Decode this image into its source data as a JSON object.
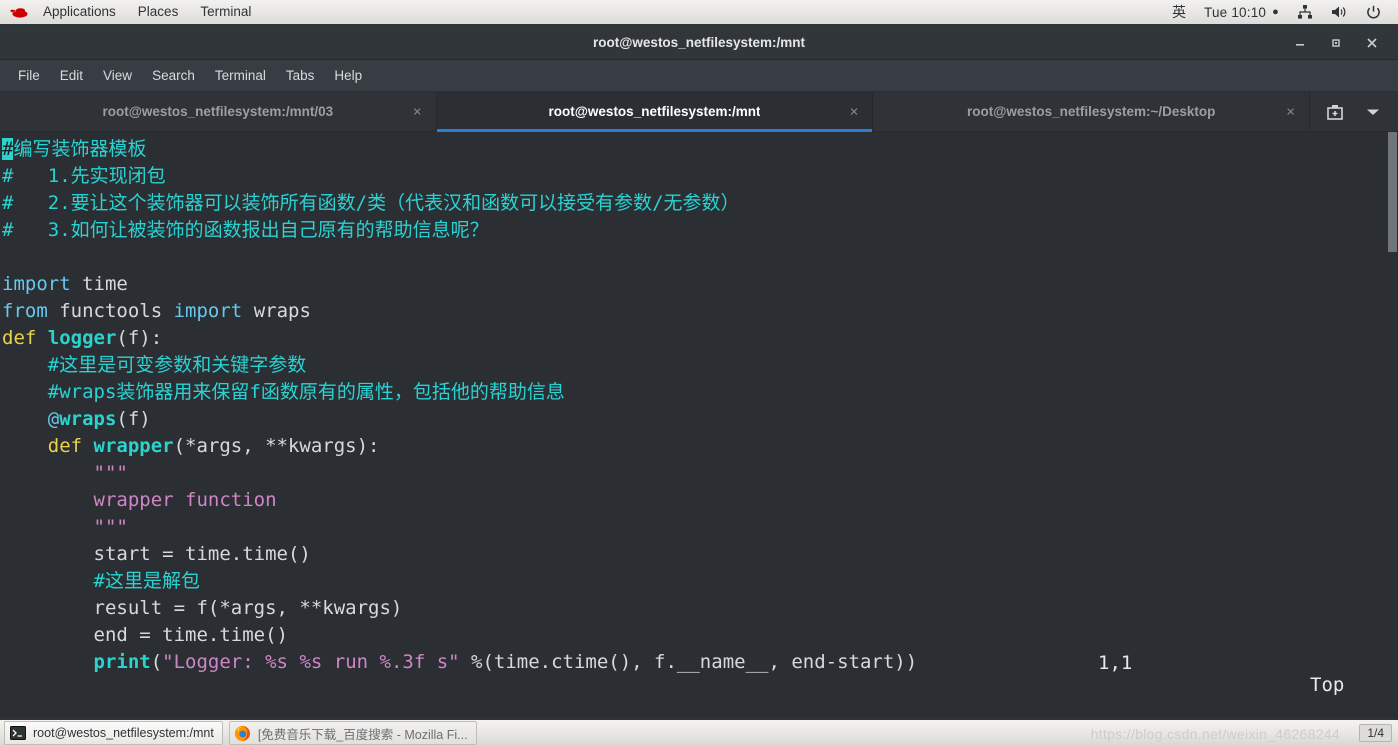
{
  "top_panel": {
    "logo_name": "red-hat-logo",
    "menus": [
      "Applications",
      "Places",
      "Terminal"
    ],
    "ime": "英",
    "clock": "Tue 10:10",
    "clock_dot": "●",
    "icons": [
      "network-icon",
      "volume-icon",
      "power-icon"
    ]
  },
  "window": {
    "title": "root@westos_netfilesystem:/mnt",
    "buttons": [
      "minimize-button",
      "maximize-button",
      "close-button"
    ]
  },
  "menubar": [
    "File",
    "Edit",
    "View",
    "Search",
    "Terminal",
    "Tabs",
    "Help"
  ],
  "tabs": [
    {
      "title": "root@westos_netfilesystem:/mnt/03",
      "active": false,
      "close": "×"
    },
    {
      "title": "root@westos_netfilesystem:/mnt",
      "active": true,
      "close": "×"
    },
    {
      "title": "root@westos_netfilesystem:~/Desktop",
      "active": false,
      "close": "×"
    }
  ],
  "tab_tools": [
    "new-tab-icon",
    "tab-list-dropdown-icon"
  ],
  "terminal": {
    "lines": [
      [
        {
          "t": "#",
          "c": "cursor"
        },
        {
          "t": "编写装饰器模板",
          "c": "c-comment"
        }
      ],
      [
        {
          "t": "#   1.先实现闭包",
          "c": "c-comment"
        }
      ],
      [
        {
          "t": "#   2.要让这个装饰器可以装饰所有函数/类（代表汉和函数可以接受有参数/无参数）",
          "c": "c-comment"
        }
      ],
      [
        {
          "t": "#   3.如何让被装饰的函数报出自己原有的帮助信息呢？",
          "c": "c-comment"
        }
      ],
      [
        {
          "t": "",
          "c": "c-plain"
        }
      ],
      [
        {
          "t": "import",
          "c": "c-kw"
        },
        {
          "t": " time",
          "c": "c-plain"
        }
      ],
      [
        {
          "t": "from",
          "c": "c-kw"
        },
        {
          "t": " functools ",
          "c": "c-plain"
        },
        {
          "t": "import",
          "c": "c-kw"
        },
        {
          "t": " wraps",
          "c": "c-plain"
        }
      ],
      [
        {
          "t": "def ",
          "c": "c-def"
        },
        {
          "t": "logger",
          "c": "c-fn"
        },
        {
          "t": "(f):",
          "c": "c-plain"
        }
      ],
      [
        {
          "t": "    #这里是可变参数和关键字参数",
          "c": "c-comment"
        }
      ],
      [
        {
          "t": "    #wraps装饰器用来保留f函数原有的属性，包括他的帮助信息",
          "c": "c-comment"
        }
      ],
      [
        {
          "t": "    @",
          "c": "c-kw"
        },
        {
          "t": "wraps",
          "c": "c-fn"
        },
        {
          "t": "(f)",
          "c": "c-plain"
        }
      ],
      [
        {
          "t": "    def ",
          "c": "c-def"
        },
        {
          "t": "wrapper",
          "c": "c-fn"
        },
        {
          "t": "(*args, **kwargs):",
          "c": "c-plain"
        }
      ],
      [
        {
          "t": "        \"\"\"",
          "c": "c-str"
        }
      ],
      [
        {
          "t": "        wrapper function",
          "c": "c-str"
        }
      ],
      [
        {
          "t": "        \"\"\"",
          "c": "c-str"
        }
      ],
      [
        {
          "t": "        start = time.time()",
          "c": "c-plain"
        }
      ],
      [
        {
          "t": "        #这里是解包",
          "c": "c-comment"
        }
      ],
      [
        {
          "t": "        result = f(*args, **kwargs)",
          "c": "c-plain"
        }
      ],
      [
        {
          "t": "        end = time.time()",
          "c": "c-plain"
        }
      ],
      [
        {
          "t": "        ",
          "c": "c-plain"
        },
        {
          "t": "print",
          "c": "c-fn"
        },
        {
          "t": "(",
          "c": "c-plain"
        },
        {
          "t": "\"Logger: %s %s run %.3f s\"",
          "c": "c-str"
        },
        {
          "t": " %(time.ctime(), f.__name__, end-start))",
          "c": "c-plain"
        }
      ]
    ],
    "status_col": "1,1",
    "status_pos": "Top"
  },
  "taskbar": {
    "items": [
      {
        "label": "root@westos_netfilesystem:/mnt",
        "icon": "terminal-icon",
        "active": true
      },
      {
        "label": "[免费音乐下载_百度搜索 - Mozilla Fi...",
        "icon": "firefox-icon",
        "active": false
      }
    ],
    "workspace": "1/4"
  },
  "watermark": "https://blog.csdn.net/weixin_46268244",
  "colors": {
    "accent": "#2a7fd4",
    "terminal_bg": "#2b2e33",
    "comment": "#29d3d3",
    "string": "#cf86c6",
    "keyword": "#67c8ef",
    "function": "#2ad4cd",
    "def_keyword": "#e8d44d"
  }
}
